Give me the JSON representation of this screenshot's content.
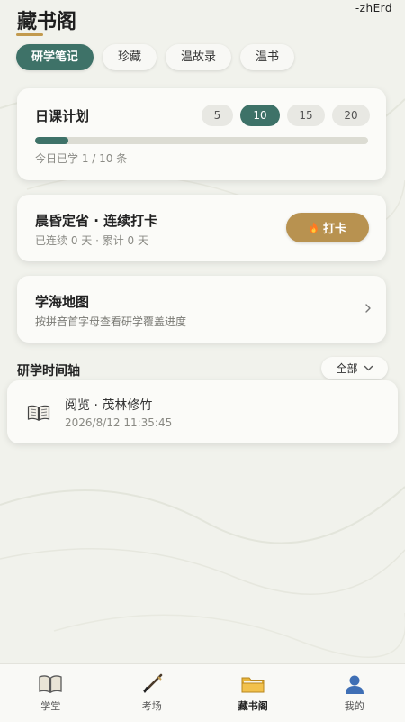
{
  "header": {
    "corner_tag": "-zhErd",
    "title": "藏书阁"
  },
  "tabs": [
    {
      "label": "研学笔记",
      "active": true
    },
    {
      "label": "珍藏",
      "active": false
    },
    {
      "label": "温故录",
      "active": false
    },
    {
      "label": "温书",
      "active": false
    }
  ],
  "daily_plan": {
    "title": "日课计划",
    "options": [
      "5",
      "10",
      "15",
      "20"
    ],
    "selected": "10",
    "progress_fraction": 0.1,
    "status": "今日已学 1 / 10 条"
  },
  "checkin": {
    "title": "晨昏定省 · 连续打卡",
    "subtitle": "已连续 0 天 · 累计 0 天",
    "button_label": "打卡",
    "button_icon": "fire-icon"
  },
  "study_map": {
    "title": "学海地图",
    "subtitle": "按拼音首字母查看研学覆盖进度"
  },
  "timeline": {
    "section_title": "研学时间轴",
    "filter_value": "全部",
    "entries": [
      {
        "icon": "book-icon",
        "action": "阅览 · 茂林修竹",
        "time": "2026/8/12 11:35:45"
      }
    ]
  },
  "bottom_nav": [
    {
      "label": "学堂",
      "icon": "book-icon",
      "active": false
    },
    {
      "label": "考场",
      "icon": "brush-icon",
      "active": false
    },
    {
      "label": "藏书阁",
      "icon": "folder-icon",
      "active": true
    },
    {
      "label": "我的",
      "icon": "user-icon",
      "active": false
    }
  ],
  "colors": {
    "accent_green": "#3e7268",
    "accent_gold": "#b89250",
    "background": "#f1f2ec"
  }
}
